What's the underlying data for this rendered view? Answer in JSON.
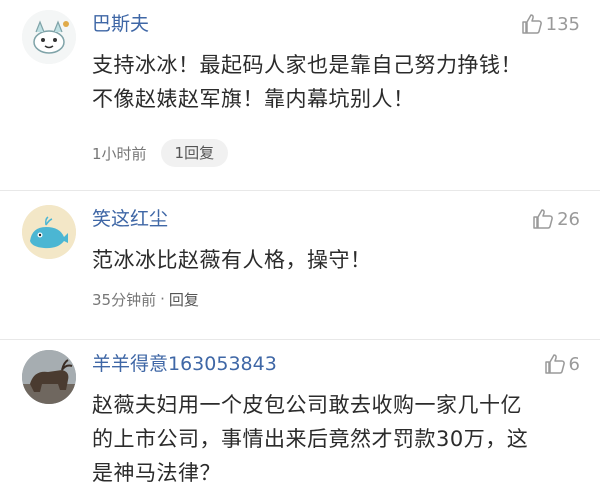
{
  "comments": [
    {
      "username": "巴斯夫",
      "likes": "135",
      "content_lines": [
        "支持冰冰！最起码人家也是靠自己努力挣钱！",
        "不像赵婊赵军旗！靠内幕坑别人！"
      ],
      "time": "1小时前",
      "separator": "·",
      "reply": "1回复",
      "avatar_icon": "cartoon-creature-avatar"
    },
    {
      "username": "笑这红尘",
      "likes": "26",
      "content_lines": [
        "范冰冰比赵薇有人格，操守！"
      ],
      "time": "35分钟前",
      "separator": "·",
      "reply": "回复",
      "avatar_icon": "cartoon-whale-avatar"
    },
    {
      "username": "羊羊得意163053843",
      "likes": "6",
      "content_lines": [
        "赵薇夫妇用一个皮包公司敢去收购一家几十亿",
        "的上市公司，事情出来后竟然才罚款30万，这",
        "是神马法律？"
      ],
      "avatar_icon": "photo-bull-avatar"
    }
  ],
  "colors": {
    "username": "#3f67a6",
    "content": "#2b2b2b",
    "meta": "#777777",
    "like": "#9a9a9a"
  }
}
